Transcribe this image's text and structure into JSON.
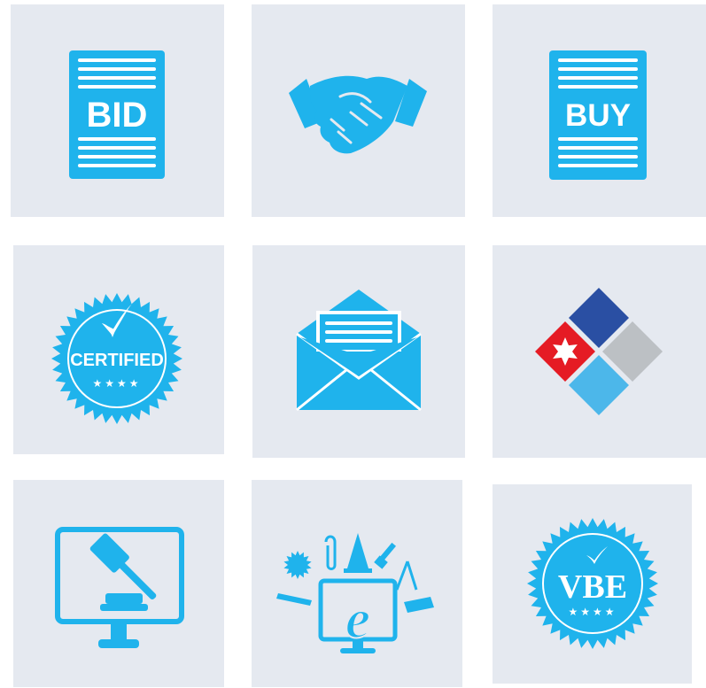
{
  "colors": {
    "tile_bg": "#e5e9f0",
    "icon_blue": "#1fb3ec",
    "navy": "#2a4fa3",
    "red": "#e51b24",
    "gray": "#bcc0c4",
    "light_blue": "#4cb7ea"
  },
  "tiles": [
    {
      "icon": "bid-document-icon",
      "label": "BID"
    },
    {
      "icon": "handshake-icon"
    },
    {
      "icon": "buy-document-icon",
      "label": "BUY"
    },
    {
      "icon": "certified-seal-icon",
      "label": "CERTIFIED",
      "stars": "★★★★"
    },
    {
      "icon": "open-envelope-icon"
    },
    {
      "icon": "chicago-star-diamond-icon"
    },
    {
      "icon": "gavel-monitor-icon"
    },
    {
      "icon": "e-procurement-monitor-icon",
      "letter": "e"
    },
    {
      "icon": "vbe-seal-icon",
      "label": "VBE",
      "stars": "★★★★"
    }
  ]
}
